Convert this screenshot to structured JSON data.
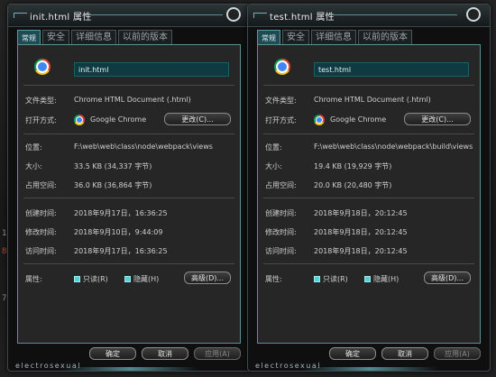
{
  "background": {
    "left_fragments": [
      "1",
      "8",
      "7."
    ]
  },
  "windows": [
    {
      "title": "init.html 属性",
      "tabs": [
        "常规",
        "安全",
        "详细信息",
        "以前的版本"
      ],
      "file_name": "init.html",
      "rows": {
        "type_label": "文件类型:",
        "type_value": "Chrome HTML Document (.html)",
        "open_label": "打开方式:",
        "open_value": "Google Chrome",
        "change_button": "更改(C)...",
        "location_label": "位置:",
        "location_value": "F:\\web\\web\\class\\node\\webpack\\views",
        "size_label": "大小:",
        "size_value": "33.5 KB (34,337 字节)",
        "disk_label": "占用空间:",
        "disk_value": "36.0 KB (36,864 字节)",
        "created_label": "创建时间:",
        "created_value": "2018年9月17日，16:36:25",
        "modified_label": "修改时间:",
        "modified_value": "2018年9月10日，9:44:09",
        "accessed_label": "访问时间:",
        "accessed_value": "2018年9月17日，16:36:25",
        "attr_label": "属性:",
        "readonly_label": "只读(R)",
        "hidden_label": "隐藏(H)",
        "advanced_button": "高级(D)..."
      },
      "buttons": {
        "ok": "确定",
        "cancel": "取消",
        "apply": "应用(A)"
      },
      "brand": "electrosexual"
    },
    {
      "title": "test.html 属性",
      "tabs": [
        "常规",
        "安全",
        "详细信息",
        "以前的版本"
      ],
      "file_name": "test.html",
      "rows": {
        "type_label": "文件类型:",
        "type_value": "Chrome HTML Document (.html)",
        "open_label": "打开方式:",
        "open_value": "Google Chrome",
        "change_button": "更改(C)...",
        "location_label": "位置:",
        "location_value": "F:\\web\\web\\class\\node\\webpack\\build\\views",
        "size_label": "大小:",
        "size_value": "19.4 KB (19,929 字节)",
        "disk_label": "占用空间:",
        "disk_value": "20.0 KB (20,480 字节)",
        "created_label": "创建时间:",
        "created_value": "2018年9月18日，20:12:45",
        "modified_label": "修改时间:",
        "modified_value": "2018年9月18日，20:12:45",
        "accessed_label": "访问时间:",
        "accessed_value": "2018年9月18日，20:12:45",
        "attr_label": "属性:",
        "readonly_label": "只读(R)",
        "hidden_label": "隐藏(H)",
        "advanced_button": "高级(D)..."
      },
      "buttons": {
        "ok": "确定",
        "cancel": "取消",
        "apply": "应用(A)"
      },
      "brand": "electrosexual"
    }
  ],
  "icons": [
    "chrome-icon",
    "window-control-icon",
    "checkbox-icon"
  ],
  "colors": {
    "accent": "#5d8f96",
    "field_bg": "#0e3b41",
    "checkbox": "#53d1d6",
    "panel_bg": "#262626"
  },
  "checkboxes": {
    "readonly_checked": true,
    "hidden_checked": true
  }
}
